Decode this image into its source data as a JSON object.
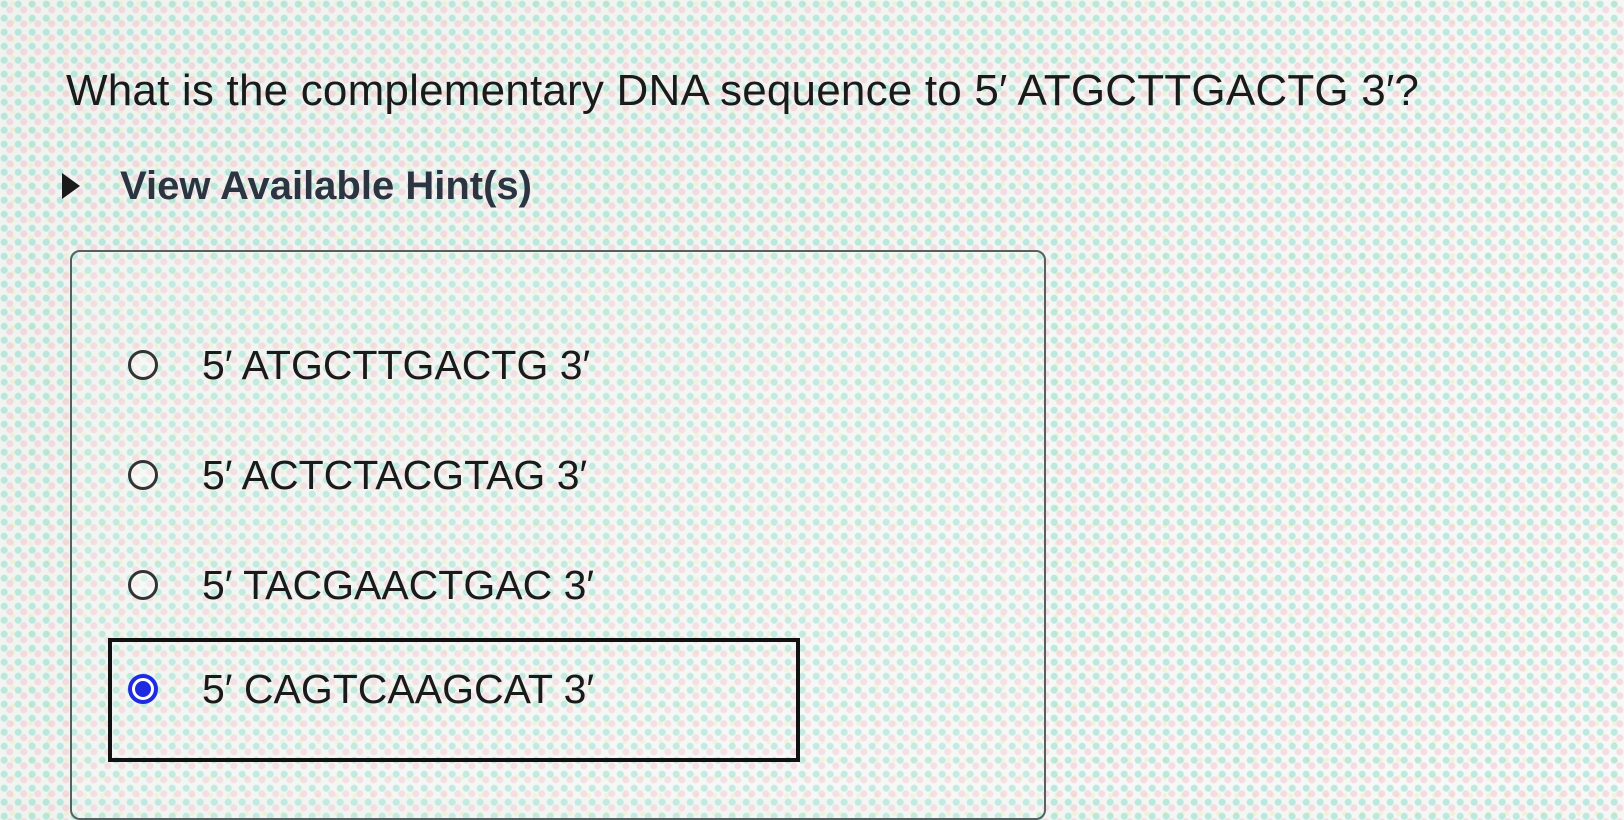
{
  "question": {
    "text": "What is the complementary DNA sequence to 5′ ATGCTTGACTG 3′?"
  },
  "hint": {
    "label": "View Available Hint(s)",
    "icon": "triangle-right-icon"
  },
  "options": [
    {
      "label": "5′ ATGCTTGACTG 3′",
      "selected": false
    },
    {
      "label": "5′ ACTCTACGTAG 3′",
      "selected": false
    },
    {
      "label": "5′ TACGAACTGAC 3′",
      "selected": false
    },
    {
      "label": "5′ CAGTCAAGCAT 3′",
      "selected": true
    }
  ],
  "colors": {
    "selected_radio": "#1e2be0",
    "text": "#1a1a1a"
  }
}
